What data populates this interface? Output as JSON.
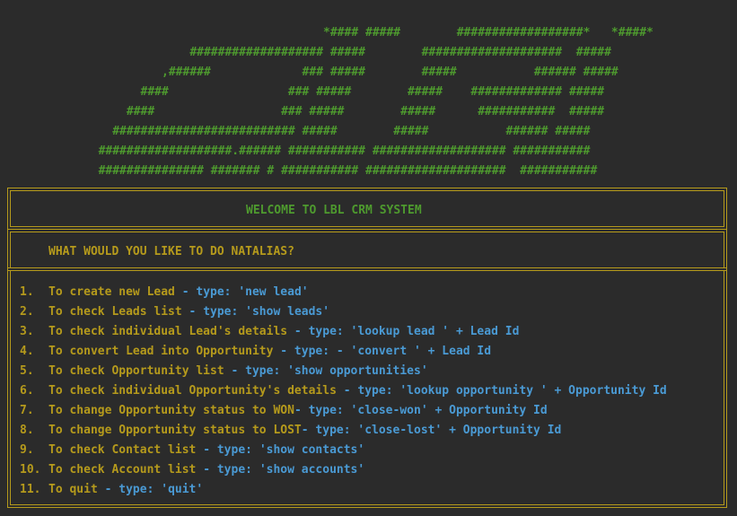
{
  "ascii_art": [
    "                                              *#### #####        ##################*   *####*",
    "                           ################### #####        ####################  #####",
    "                       ,######             ### #####        #####           ###### #####",
    "                    ####                 ### #####        #####    ############# #####",
    "                  ####                  ### #####        #####      ###########  #####",
    "                ########################## #####        #####           ###### #####",
    "              ###################.###### ########### ################### ###########",
    "              ############### ####### # ########### ####################  ###########"
  ],
  "welcome": "WELCOME TO LBL CRM SYSTEM",
  "question": "WHAT WOULD YOU LIKE TO DO NATALIAS?",
  "menu": [
    {
      "num": "1.",
      "desc": "To create new Lead",
      "cmd": " - type: 'new lead'"
    },
    {
      "num": "2.",
      "desc": "To check Leads list",
      "cmd": " - type: 'show leads'"
    },
    {
      "num": "3.",
      "desc": "To check individual Lead's details",
      "cmd": " - type: 'lookup lead ' + Lead Id"
    },
    {
      "num": "4.",
      "desc": "To convert Lead into Opportunity",
      "cmd": " - type: - 'convert ' + Lead Id"
    },
    {
      "num": "5.",
      "desc": "To check Opportunity list",
      "cmd": " - type: 'show opportunities'"
    },
    {
      "num": "6.",
      "desc": "To check individual Opportunity's details",
      "cmd": " - type: 'lookup opportunity ' + Opportunity Id"
    },
    {
      "num": "7.",
      "desc": "To change Opportunity status to WON",
      "cmd": "- type: 'close-won' + Opportunity Id"
    },
    {
      "num": "8.",
      "desc": "To change Opportunity status to LOST",
      "cmd": "- type: 'close-lost' + Opportunity Id"
    },
    {
      "num": "9.",
      "desc": "To check Contact list",
      "cmd": " - type: 'show contacts'"
    },
    {
      "num": "10.",
      "desc": "To check Account list",
      "cmd": " - type: 'show accounts'"
    },
    {
      "num": "11.",
      "desc": "To quit",
      "cmd": " - type: 'quit'"
    }
  ],
  "colors": {
    "background": "#2b2b2b",
    "green": "#4e9a2e",
    "yellow": "#b59a1c",
    "blue": "#4a9ad4"
  }
}
